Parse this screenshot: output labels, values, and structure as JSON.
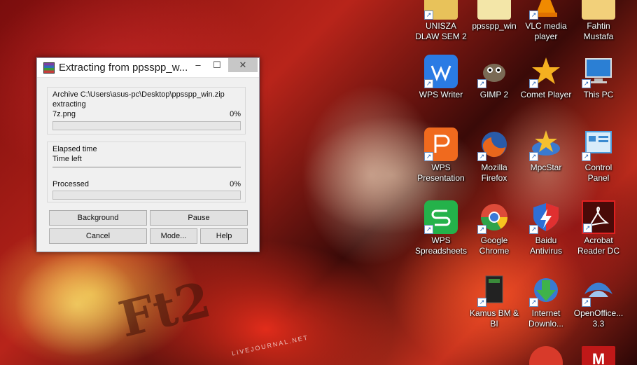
{
  "dialog": {
    "title": "Extracting from ppsspp_w...",
    "archive_line": "Archive C:\\Users\\asus-pc\\Desktop\\ppsspp_win.zip",
    "action": "extracting",
    "current_file": "7z.png",
    "file_percent": "0%",
    "file_progress": 0,
    "elapsed_label": "Elapsed time",
    "time_left_label": "Time left",
    "processed_label": "Processed",
    "processed_percent": "0%",
    "processed_progress": 0,
    "buttons": {
      "background": "Background",
      "pause": "Pause",
      "cancel": "Cancel",
      "mode": "Mode...",
      "help": "Help"
    },
    "window_controls": {
      "minimize": "–",
      "maximize": "☐",
      "close": "✕"
    }
  },
  "desktop": {
    "watermark": "Ft2",
    "watermark_sub": "LIVEJOURNAL.NET",
    "icons": [
      {
        "label": "UNISZA\nDLAW SEM 2",
        "icon": "folder-icon",
        "color": "#e8c25a"
      },
      {
        "label": "ppsspp_win",
        "icon": "folder-icon",
        "color": "#f3e6a8"
      },
      {
        "label": "VLC media\nplayer",
        "icon": "vlc-icon",
        "color": "#f08a00"
      },
      {
        "label": "Fahtin\nMustafa",
        "icon": "user-folder-icon",
        "color": "#f2d07a"
      },
      {
        "label": "WPS Writer",
        "icon": "wps-writer-icon",
        "color": "#2a7be4"
      },
      {
        "label": "GIMP 2",
        "icon": "gimp-icon",
        "color": "#6b5a44"
      },
      {
        "label": "Comet Player",
        "icon": "comet-player-icon",
        "color": "#f0a020"
      },
      {
        "label": "This PC",
        "icon": "computer-icon",
        "color": "#3b8fd8"
      },
      {
        "label": "WPS\nPresentation",
        "icon": "wps-presentation-icon",
        "color": "#f06a1e"
      },
      {
        "label": "Mozilla\nFirefox",
        "icon": "firefox-icon",
        "color": "#e66a1a"
      },
      {
        "label": "MpcStar",
        "icon": "mpcstar-icon",
        "color": "#3a7ad0"
      },
      {
        "label": "Control\nPanel",
        "icon": "control-panel-icon",
        "color": "#4fa0e0"
      },
      {
        "label": "WPS\nSpreadsheets",
        "icon": "wps-spreadsheets-icon",
        "color": "#24b24a"
      },
      {
        "label": "Google\nChrome",
        "icon": "chrome-icon",
        "color": "#dd4b39"
      },
      {
        "label": "Baidu\nAntivirus",
        "icon": "baidu-antivirus-icon",
        "color": "#2e6fd6"
      },
      {
        "label": "Acrobat\nReader DC",
        "icon": "acrobat-icon",
        "color": "#b30b00"
      },
      {
        "label": "Kamus BM &\nBI",
        "icon": "kamus-icon",
        "color": "#333333"
      },
      {
        "label": "Internet\nDownlo...",
        "icon": "idm-icon",
        "color": "#2f9a3a"
      },
      {
        "label": "OpenOffice...\n3.3",
        "icon": "openoffice-icon",
        "color": "#3c7fd1"
      },
      {
        "label": "",
        "icon": "ccleaner-icon",
        "color": "#d83a2a"
      },
      {
        "label": "",
        "icon": "mcafee-icon",
        "color": "#c01818"
      }
    ]
  }
}
